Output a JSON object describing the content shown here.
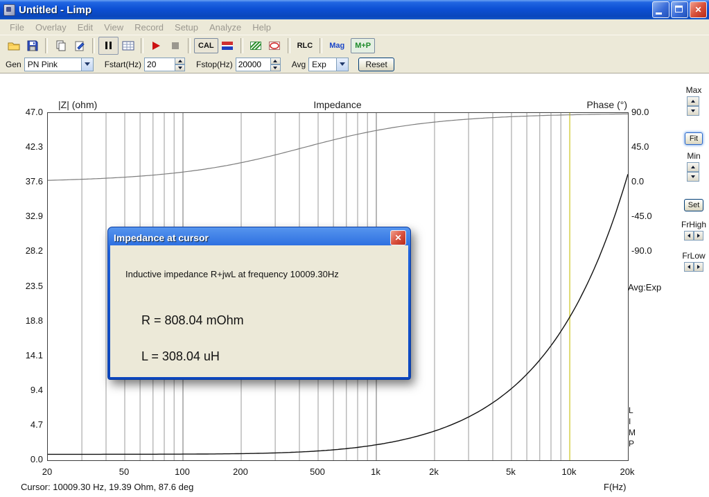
{
  "icons": {
    "close_glyph": "✕"
  },
  "window": {
    "title": "Untitled - Limp",
    "menu": [
      "File",
      "Overlay",
      "Edit",
      "View",
      "Record",
      "Setup",
      "Analyze",
      "Help"
    ]
  },
  "toolbar": {
    "cal_label": "CAL",
    "rlc_label": "RLC",
    "mag_label": "Mag",
    "mp_label": "M+P"
  },
  "settings": {
    "gen_label": "Gen",
    "gen_value": "PN Pink",
    "fstart_label": "Fstart(Hz)",
    "fstart_value": "20",
    "fstop_label": "Fstop(Hz)",
    "fstop_value": "20000",
    "avg_label": "Avg",
    "avg_value": "Exp",
    "reset_label": "Reset"
  },
  "side_panel": {
    "max_label": "Max",
    "fit_label": "Fit",
    "min_label": "Min",
    "set_label": "Set",
    "frhigh_label": "FrHigh",
    "frlow_label": "FrLow",
    "avg_text": "Avg:Exp"
  },
  "chart_data": {
    "type": "line",
    "title": "Impedance",
    "watermark": "L I M P",
    "x_axis": {
      "label": "F(Hz)",
      "scale": "log",
      "range_hz": [
        20,
        20000
      ],
      "tick_values": [
        20,
        50,
        100,
        200,
        500,
        1000,
        2000,
        5000,
        10000,
        20000
      ],
      "tick_labels": [
        "20",
        "50",
        "100",
        "200",
        "500",
        "1k",
        "2k",
        "5k",
        "10k",
        "20k"
      ]
    },
    "y_axis_impedance": {
      "label": "|Z| (ohm)",
      "range_ohm": [
        0,
        47
      ],
      "tick_labels": [
        "47.0",
        "42.3",
        "37.6",
        "32.9",
        "28.2",
        "23.5",
        "18.8",
        "14.1",
        "9.4",
        "4.7",
        "0.0"
      ]
    },
    "y_axis_phase": {
      "label": "Phase (°)",
      "max_deg": 90,
      "min_deg": -90,
      "fraction_of_height": 0.4,
      "tick_labels": [
        "90.0",
        "45.0",
        "0.0",
        "-45.0",
        "-90.0"
      ]
    },
    "model": {
      "description": "inductive impedance R+jwL",
      "R_ohm": 0.80804,
      "L_H": 0.00030804
    },
    "series": [
      {
        "name": "impedance-magnitude",
        "color": "#101010",
        "x_hz": [
          20,
          50,
          100,
          200,
          500,
          1000,
          2000,
          5000,
          10000,
          20000
        ],
        "z_ohm": [
          0.81,
          0.81,
          0.83,
          0.9,
          1.26,
          2.1,
          3.96,
          9.71,
          19.39,
          38.72
        ]
      },
      {
        "name": "phase",
        "color": "#7d7d7d",
        "x_hz": [
          20,
          50,
          100,
          200,
          500,
          1000,
          2000,
          5000,
          10000,
          20000
        ],
        "phase_deg": [
          2.7,
          6.8,
          13.5,
          25.6,
          50.1,
          67.3,
          78.2,
          85.2,
          87.6,
          88.8
        ]
      }
    ],
    "cursor": {
      "frequency_hz": 10009.3,
      "impedance_ohm": 19.39,
      "phase_deg": 87.6,
      "color": "#d2cc3a"
    }
  },
  "dialog": {
    "title": "Impedance at cursor",
    "message": "Inductive impedance R+jwL at frequency 10009.30Hz",
    "r_line": "R = 808.04 mOhm",
    "l_line": "L = 308.04 uH"
  },
  "status_bar": {
    "cursor_text": "Cursor: 10009.30 Hz, 19.39 Ohm, 87.6 deg"
  }
}
